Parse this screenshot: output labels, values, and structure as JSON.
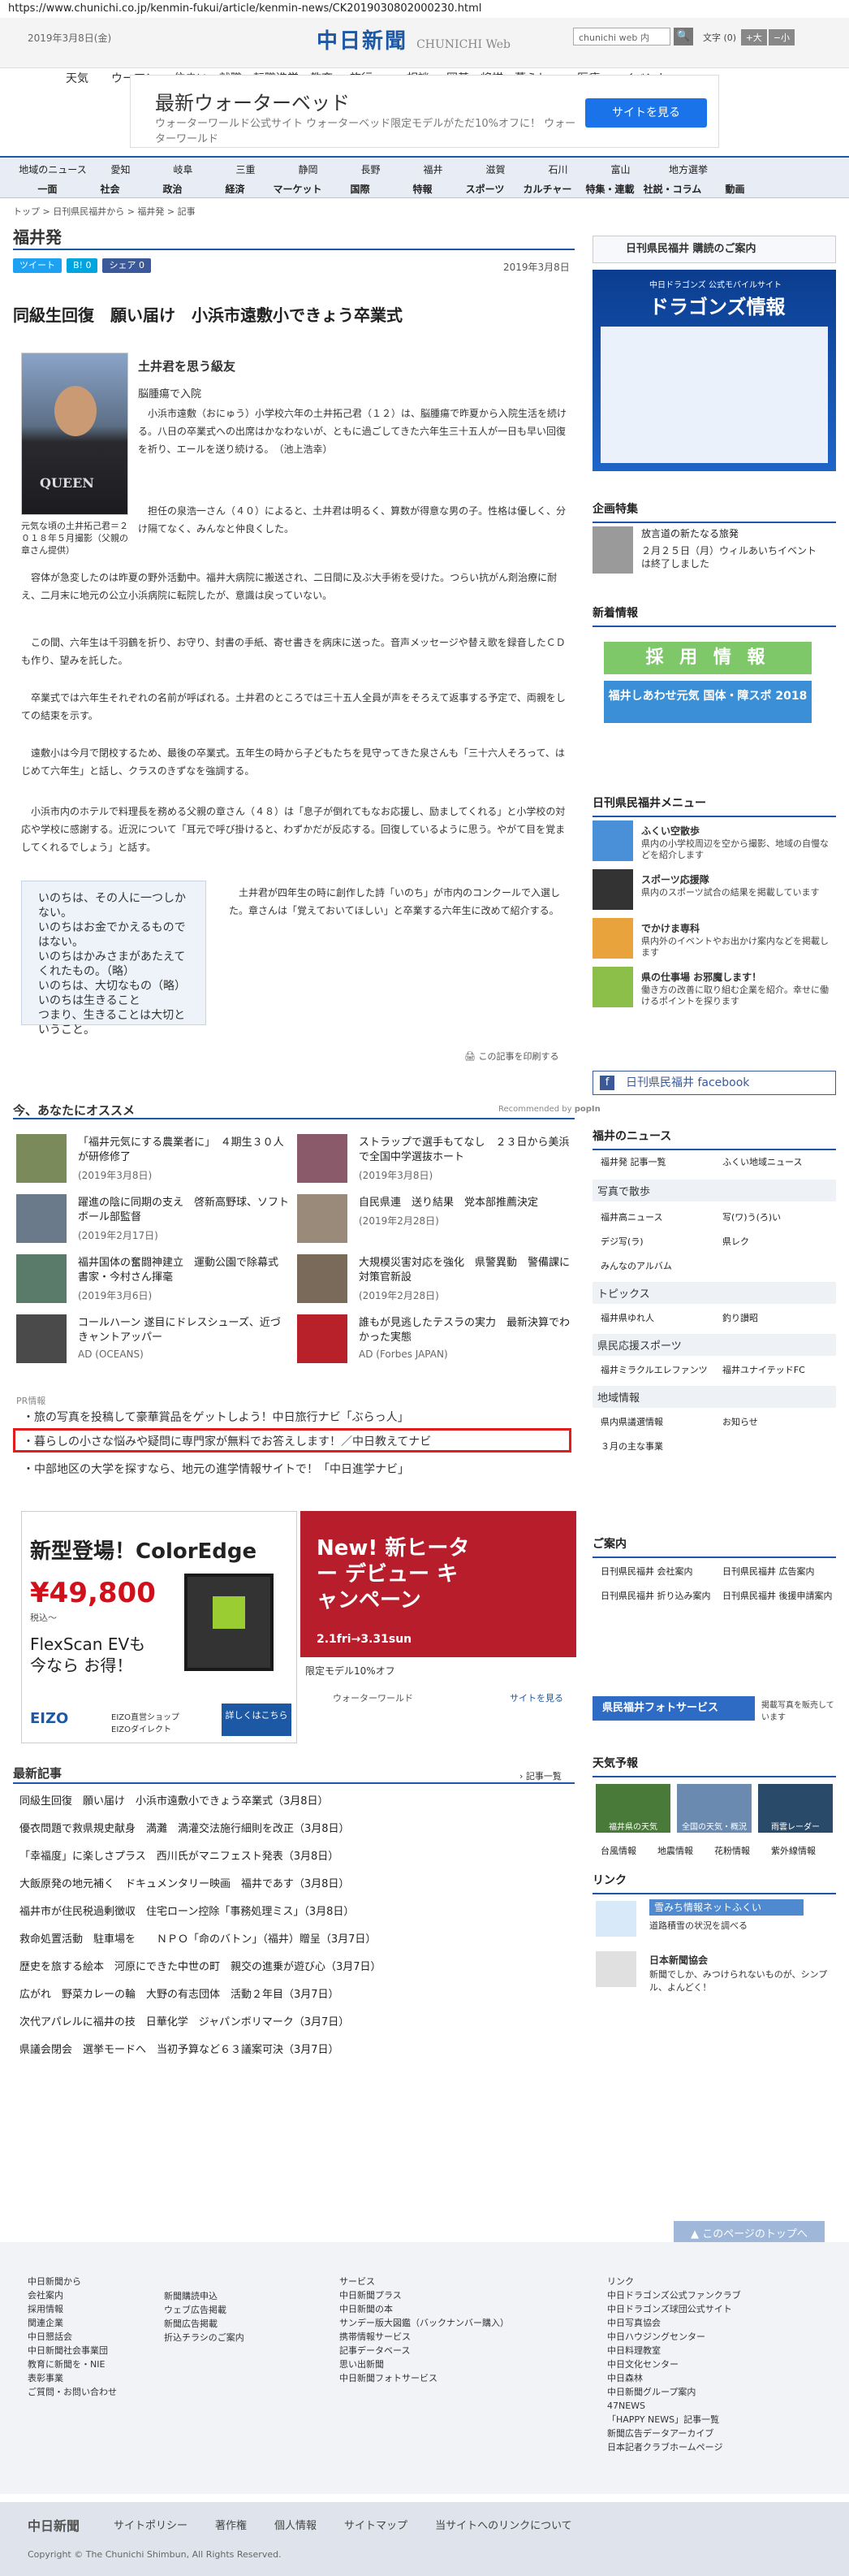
{
  "url": "https://www.chunichi.co.jp/kenmin-fukui/article/kenmin-news/CK2019030802000230.html",
  "header": {
    "date": "2019年3月8日(金)",
    "logo_main": "中日新聞",
    "logo_sub": "CHUNICHI Web",
    "search_placeholder": "chunichi web 内",
    "search_btn": "🔍",
    "text_size_label": "文字",
    "size_zero": "(0)",
    "size_big": "+大",
    "size_small": "−小"
  },
  "nav_main": [
    "天気",
    "ウーマン",
    "住まい",
    "就職・転職",
    "進学・教育",
    "旅行",
    "相談",
    "囲碁・将棋",
    "暮らし",
    "医療",
    "イベント"
  ],
  "ad_top": {
    "title": "最新ウォーターベッド",
    "sub": "ウォーターワールド公式サイト ウォーターベッド限定モデルがただ10%オフに！ ウォーターワールド",
    "button": "サイトを見る"
  },
  "nav_row1": [
    "地域のニュース",
    "愛知",
    "岐阜",
    "三重",
    "静岡",
    "長野",
    "福井",
    "滋賀",
    "石川",
    "富山",
    "地方選挙"
  ],
  "nav_row2": [
    "一面",
    "社会",
    "政治",
    "経済",
    "マーケット",
    "国際",
    "特報",
    "スポーツ",
    "カルチャー",
    "特集・連載",
    "社説・コラム",
    "動画"
  ],
  "breadcrumb": "トップ > 日刊県民福井から > 福井発 > 記事",
  "page_title": "福井発",
  "share": {
    "tweet": "ツイート",
    "b": "B! 0",
    "fb": "シェア 0"
  },
  "article_date": "2019年3月8日",
  "article": {
    "title": "同級生回復　願い届け　小浜市遠敷小できょう卒業式",
    "subhead1": "土井君を思う級友",
    "subhead2": "脳腫瘍で入院",
    "photo_caption": "元気な頃の土井拓己君＝２０１８年５月撮影（父親の章さん提供）",
    "p1": "　小浜市遠敷（おにゅう）小学校六年の土井拓己君（１２）は、脳腫瘍で昨夏から入院生活を続ける。八日の卒業式への出席はかなわないが、ともに過ごしてきた六年生三十五人が一日も早い回復を祈り、エールを送り続ける。　（池上浩幸）",
    "p2": "　担任の泉浩一さん（４０）によると、土井君は明るく、算数が得意な男の子。性格は優しく、分け隔てなく、みんなと仲良くした。",
    "p3": "　容体が急変したのは昨夏の野外活動中。福井大病院に搬送され、二日間に及ぶ大手術を受けた。つらい抗がん剤治療に耐え、二月末に地元の公立小浜病院に転院したが、意識は戻っていない。",
    "p4": "　この間、六年生は千羽鶴を折り、お守り、封書の手紙、寄せ書きを病床に送った。音声メッセージや替え歌を録音したＣＤも作り、望みを託した。",
    "p5": "　卒業式では六年生それぞれの名前が呼ばれる。土井君のところでは三十五人全員が声をそろえて返事する予定で、両親をしての結束を示す。",
    "p6": "　遠敷小は今月で閉校するため、最後の卒業式。五年生の時から子どもたちを見守ってきた泉さんも「三十六人そろって、はじめて六年生」と話し、クラスのきずなを強調する。",
    "p7": "　小浜市内のホテルで料理長を務める父親の章さん（４８）は「息子が倒れてもなお応援し、励ましてくれる」と小学校の対応や学校に感謝する。近況について「耳元で呼び掛けると、わずかだが反応する。回復しているように思う。やがて目を覚ましてくれるでしょう」と話す。",
    "poem": [
      "いのちは、その人に一つしかない。",
      "いのちはお金でかえるものではない。",
      "いのちはかみさまがあたえてくれたもの。（略）",
      "いのちは、大切なもの（略）いのちは生きること",
      "つまり、生きることは大切ということ。"
    ],
    "p8": "　土井君が四年生の時に創作した詩「いのち」が市内のコンクールで入選した。章さんは「覚えておいてほしい」と卒業する六年生に改めて紹介する。",
    "print": "この記事を印刷する"
  },
  "recommend": {
    "heading": "今、あなたにオススメ",
    "by": "Recommended by",
    "popin": "popIn",
    "items": [
      {
        "title": "「福井元気にする農業者に」　４期生３０人が研修修了",
        "date": "(2019年3月8日)"
      },
      {
        "title": "ストラップで選手もてなし　２３日から美浜で全国中学選抜ホート",
        "date": "(2019年3月8日)"
      },
      {
        "title": "躍進の陰に同期の支え　啓新高野球、ソフトボール部監督",
        "date": "(2019年2月17日)"
      },
      {
        "title": "自民県連　送り結果　党本部推薦決定",
        "date": "(2019年2月28日)"
      },
      {
        "title": "福井国体の奮闘神建立　運動公園で除幕式　書家・今村さん揮毫",
        "date": "(2019年3月6日)"
      },
      {
        "title": "大規模災害対応を強化　県警異動　警備課に対策官新設",
        "date": "(2019年2月28日)"
      },
      {
        "title": "コールハーン 遂目にドレスシューズ、近づきャントアッパー",
        "date": "AD (OCEANS)"
      },
      {
        "title": "誰もが見逃したテスラの実力　最新決算でわかった実態",
        "date": "AD (Forbes JAPAN)"
      }
    ]
  },
  "pr": {
    "label": "PR情報",
    "items": [
      "旅の写真を投稿して豪華賞品をゲットしよう！中日旅行ナビ「ぶらっ人」",
      "暮らしの小さな悩みや疑問に専門家が無料でお答えします！／中日教えてナビ",
      "中部地区の大学を探すなら、地元の進学情報サイトで！「中日進学ナビ」"
    ]
  },
  "ad_mid": {
    "headline": "新型登場！ColorEdge",
    "price": "¥49,800",
    "price_note": "税込〜",
    "product": "FlexScan EVも今なら お得！",
    "brand": "EIZO",
    "shop": "EIZO直営ショップ EIZOダイレクト",
    "cta": "詳しくはこちら",
    "right_title": "New! 新ヒーター デビュー キャンペーン",
    "right_date": "2.1fri→3.31sun",
    "right_sub": "限定モデル10%オフ",
    "right_brand": "ウォーターワールド",
    "right_link": "サイトを見る"
  },
  "recent": {
    "heading": "最新記事",
    "more": "記事一覧",
    "items": [
      "同級生回復　願い届け　小浜市遠敷小できょう卒業式（3月8日）",
      "優衣問題で救県規史献身　満灘　満灌交法施行細則を改正（3月8日）",
      "「幸福度」に楽しさプラス　西川氏がマニフェスト発表（3月8日）",
      "大飯原発の地元補く　ドキュメンタリー映画　福井であす（3月8日）",
      "福井市が住民税過剰徴収　住宅ローン控除「事務処理ミス」（3月8日）",
      "救命処置活動　駐車場を　　ＮＰＯ「命のバトン」（福井）贈呈（3月7日）",
      "歴史を旅する絵本　河原にできた中世の町　親交の進乗が遊び心（3月7日）",
      "広がれ　野菜カレーの輪　大野の有志団体　活動２年目（3月7日）",
      "次代アパレルに福井の技　日華化学　ジャパンボリマーク（3月7日）",
      "県議会閉会　選挙モードへ　当初予算など６３議案可決（3月7日）"
    ]
  },
  "sidebar": {
    "subscribe": "日刊県民福井 購読のご案内",
    "dragons_small": "中日ドラゴンズ 公式モバイルサイト",
    "dragons_big": "ドラゴンズ情報",
    "kikaku": "企画特集",
    "kikaku_title": "放言道の新たなる旅発",
    "kikaku_text": "２月２５日（月）ウィルあいちイベントは終了しました",
    "shinchaku": "新着情報",
    "saiyo": "採 用 情 報",
    "shiawase": "福井しあわせ元気 国体・障スポ 2018",
    "menu_head": "日刊県民福井メニュー",
    "menu": [
      {
        "t": "ふくい空散歩",
        "d": "県内の小学校周辺を空から撮影、地域の自慢などを紹介します"
      },
      {
        "t": "スポーツ応援隊",
        "d": "県内のスポーツ試合の結果を掲載しています"
      },
      {
        "t": "でかけま専科",
        "d": "県内外のイベントやお出かけ案内などを掲載します"
      },
      {
        "t": "県の仕事場 お邪魔します！",
        "d": "働き方の改善に取り組む企業を紹介。幸せに働けるポイントを探ります"
      }
    ],
    "facebook": "日刊県民福井 facebook",
    "fukui_news": "福井のニュース",
    "fukui_links": [
      "福井発 記事一覧",
      "ふくい地域ニュース"
    ],
    "photo_head": "写真で散歩",
    "photo_links": [
      "福井高ニュース",
      "写(ワ)う(ろ)い",
      "デジ写(ラ)",
      "県レク"
    ],
    "album": "みんなのアルバム",
    "topics": "トピックス",
    "topics_links": [
      "福井県ゆれ人",
      "釣り讃昭"
    ],
    "sports": "県民応援スポーツ",
    "sports_links": [
      "福井ミラクルエレファンツ",
      "福井ユナイテッドFC"
    ],
    "area": "地域情報",
    "area_links": [
      "県内県議選情報",
      "お知らせ"
    ],
    "area_links2": [
      "３月の主な事業"
    ],
    "goannai": "ご案内",
    "goannai_links": [
      "日刊県民福井 会社案内",
      "日刊県民福井 広告案内",
      "日刊県民福井 折り込み案内",
      "日刊県民福井 後援申請案内"
    ],
    "photo_service": "県民福井フォトサービス",
    "photo_service_note": "掲載写真を販売しています",
    "tenki": "天気予報",
    "tenki_items": [
      "福井県の天気",
      "全国の天気・概況",
      "雨雲レーダー"
    ],
    "tenki_links": [
      "台風情報",
      "地震情報",
      "花粉情報",
      "紫外線情報"
    ],
    "link": "リンク",
    "link_items": [
      {
        "t": "雪みち情報ネットふくい",
        "d": "道路積雪の状況を調べる"
      },
      {
        "t": "日本新聞協会",
        "d": "新聞でしか、みつけられないものが、シンプル、よんどく！"
      }
    ]
  },
  "footer": {
    "top_btn": "このページのトップへ",
    "col1": [
      "中日新聞から",
      "会社案内",
      "採用情報",
      "関連企業",
      "中日懇話会",
      "中日新聞社会事業団",
      "教育に新聞を・NIE",
      "表彰事業",
      "ご質問・お問い合わせ"
    ],
    "col2": [
      "新聞購読申込",
      "ウェブ広告掲載",
      "新聞広告掲載",
      "折込チラシのご案内"
    ],
    "col3": [
      "サービス",
      "中日新聞プラス",
      "中日新聞の本",
      "サンデー版大図鑑（バックナンバー購入）",
      "携帯情報サービス",
      "記事データベース",
      "思い出新聞",
      "中日新聞フォトサービス"
    ],
    "col4": [
      "リンク",
      "中日ドラゴンズ公式ファンクラブ",
      "中日ドラゴンズ球団公式サイト",
      "中日写真協会",
      "中日ハウジングセンター",
      "中日料理教室",
      "中日文化センター",
      "中日森林",
      "中日新聞グループ案内",
      "47NEWS",
      "「HAPPY NEWS」記事一覧",
      "新聞広告データアーカイブ",
      "日本記者クラブホームページ"
    ],
    "bottom_logo": "中日新聞",
    "bottom_links": [
      "サイトポリシー",
      "著作権",
      "個人情報",
      "サイトマップ",
      "当サイトへのリンクについて"
    ],
    "copyright": "Copyright © The Chunichi Shimbun, All Rights Reserved."
  }
}
